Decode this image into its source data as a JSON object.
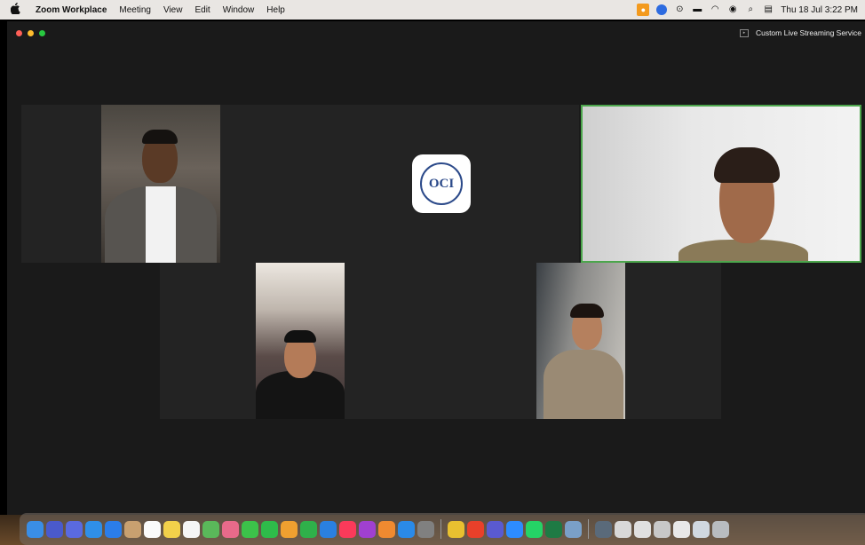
{
  "menubar": {
    "app_name": "Zoom Workplace",
    "menus": [
      "Meeting",
      "View",
      "Edit",
      "Window",
      "Help"
    ],
    "clock": "Thu 18 Jul  3:22 PM"
  },
  "window": {
    "streaming_label": "Custom Live Streaming Service"
  },
  "logo": {
    "text": "OCI"
  }
}
